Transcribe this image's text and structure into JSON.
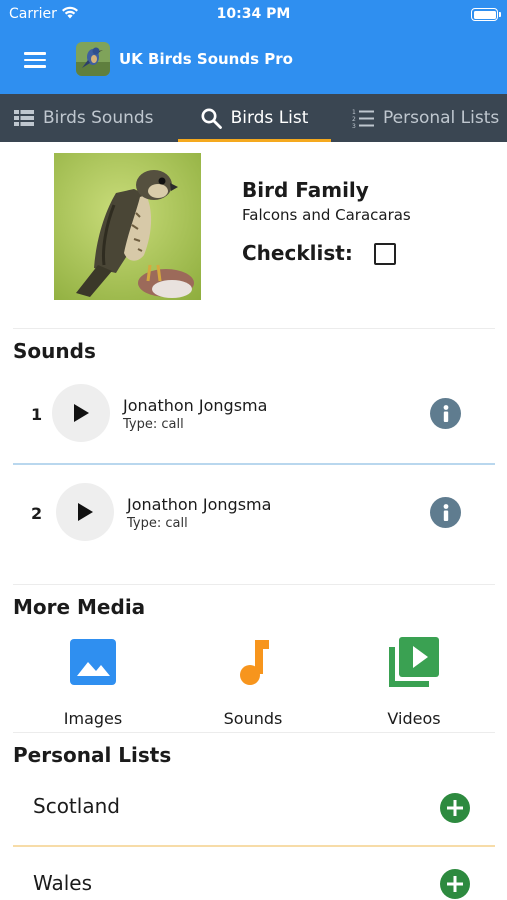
{
  "status_bar": {
    "carrier": "Carrier",
    "time": "10:34 PM"
  },
  "header": {
    "title": "UK Birds Sounds Pro",
    "menu_icon": "hamburger-menu-icon",
    "app_icon": "bird-app-icon"
  },
  "tabs": [
    {
      "label": "Birds Sounds",
      "icon": "table-list-icon",
      "active": false
    },
    {
      "label": "Birds List",
      "icon": "search-icon",
      "active": true
    },
    {
      "label": "Personal Lists",
      "icon": "numbered-list-icon",
      "active": false
    }
  ],
  "bird": {
    "family_heading": "Bird Family",
    "family_name": "Falcons and Caracaras",
    "checklist_label": "Checklist:",
    "checklist_checked": false
  },
  "sounds": {
    "title": "Sounds",
    "items": [
      {
        "index": "1",
        "author": "Jonathon Jongsma",
        "type": "Type: call"
      },
      {
        "index": "2",
        "author": "Jonathon Jongsma",
        "type": "Type: call"
      }
    ]
  },
  "more_media": {
    "title": "More Media",
    "items": [
      {
        "label": "Images",
        "icon": "image-icon",
        "color": "#2f8ff0"
      },
      {
        "label": "Sounds",
        "icon": "music-note-icon",
        "color": "#f7951d"
      },
      {
        "label": "Videos",
        "icon": "video-library-icon",
        "color": "#3aa152"
      }
    ]
  },
  "personal_lists": {
    "title": "Personal Lists",
    "items": [
      {
        "name": "Scotland"
      },
      {
        "name": "Wales"
      }
    ]
  },
  "colors": {
    "header_blue": "#2f8ff0",
    "tab_bar": "#3a4652",
    "active_tab_underline": "#f5a91e",
    "info_button": "#5f7c8f",
    "add_button_green": "#2d8a3f"
  }
}
